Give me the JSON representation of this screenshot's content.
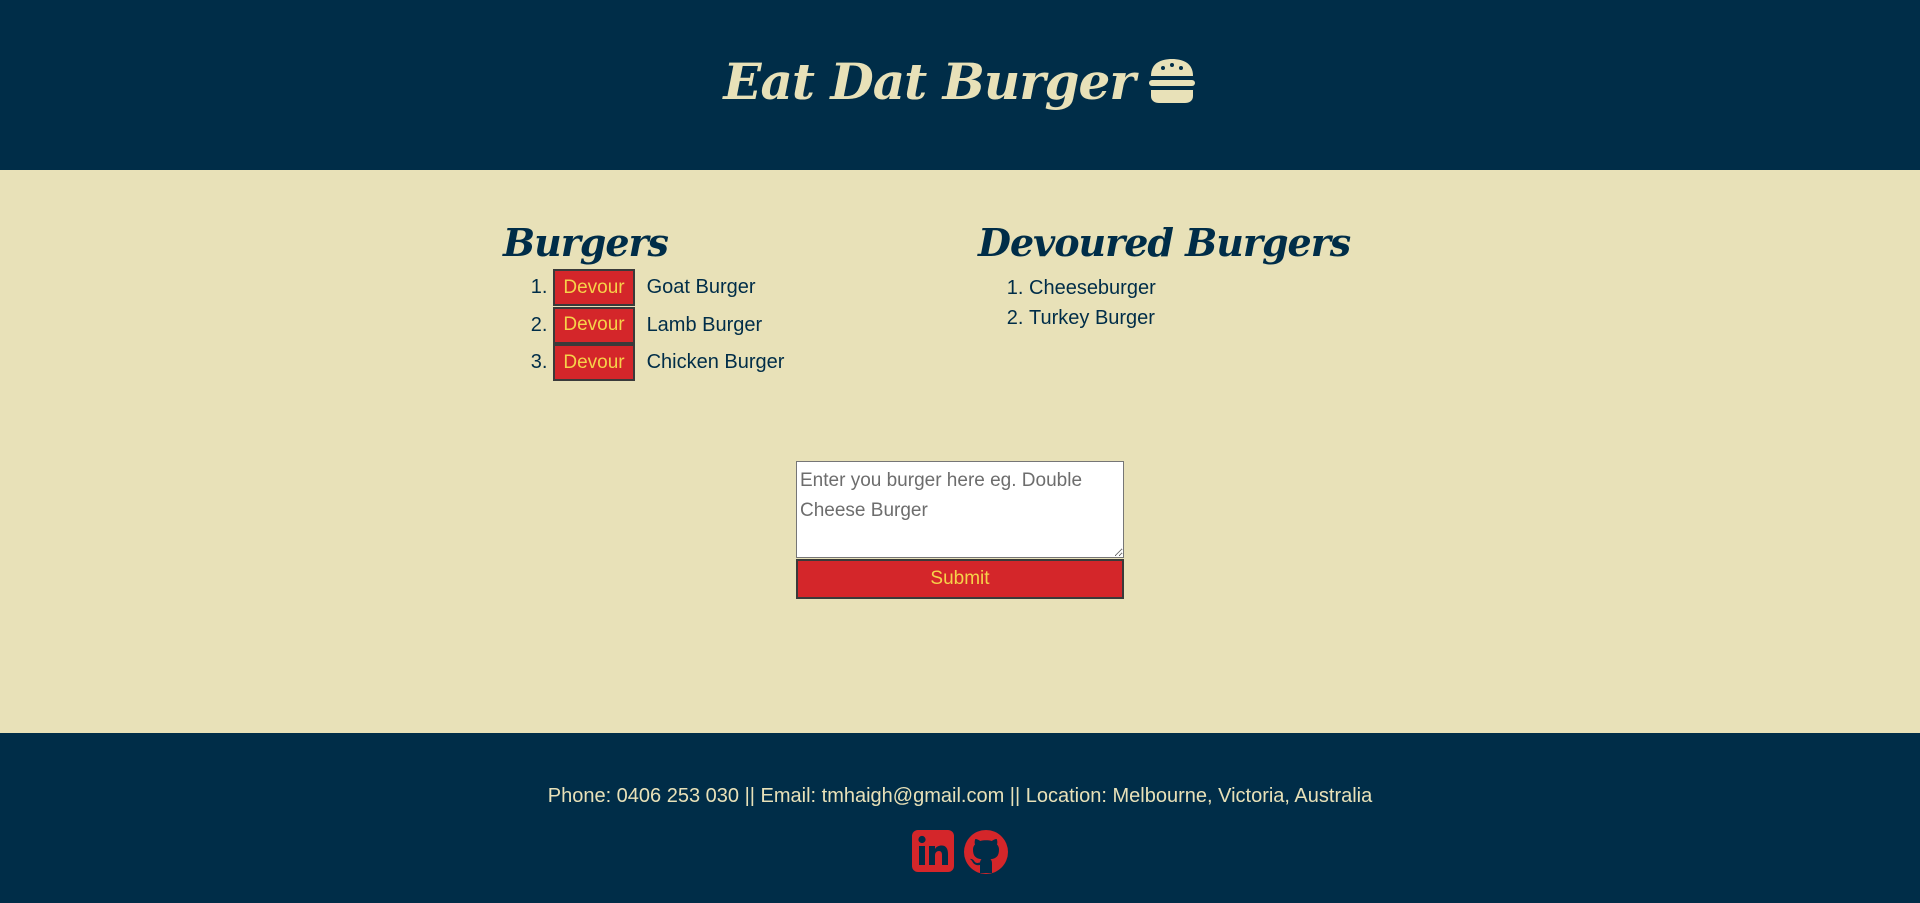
{
  "header": {
    "title": "Eat Dat Burger",
    "icon": "hamburger-icon"
  },
  "burgers": {
    "heading": "Burgers",
    "button_label": "Devour",
    "items": [
      {
        "name": "Goat Burger"
      },
      {
        "name": "Lamb Burger"
      },
      {
        "name": "Chicken Burger"
      }
    ]
  },
  "devoured": {
    "heading": "Devoured Burgers",
    "items": [
      {
        "name": "Cheeseburger"
      },
      {
        "name": "Turkey Burger"
      }
    ]
  },
  "form": {
    "placeholder": "Enter you burger here eg. Double Cheese Burger",
    "value": "",
    "submit_label": "Submit"
  },
  "footer": {
    "contact": "Phone: 0406 253 030 || Email: tmhaigh@gmail.com || Location: Melbourne, Victoria, Australia",
    "social": [
      {
        "icon": "linkedin-icon"
      },
      {
        "icon": "github-icon"
      }
    ]
  },
  "colors": {
    "navy": "#002d48",
    "cream": "#e8e1b8",
    "red": "#d4262a",
    "yellow": "#f6d24a"
  }
}
